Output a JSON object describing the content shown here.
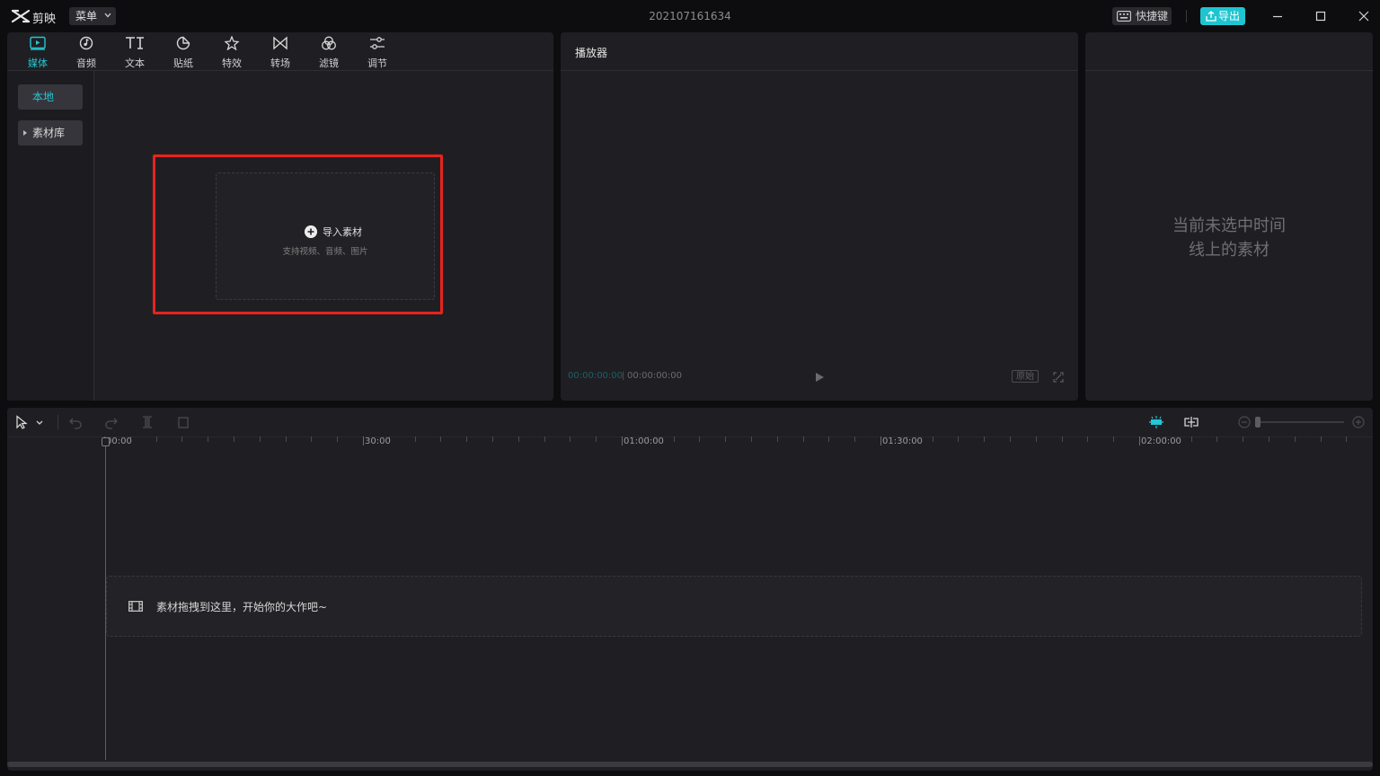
{
  "titlebar": {
    "app_name": "剪映",
    "menu_label": "菜单",
    "project_title": "202107161634",
    "shortcut_label": "快捷键",
    "export_label": "导出"
  },
  "media": {
    "tabs": [
      {
        "label": "媒体",
        "icon": "media-icon",
        "active": true
      },
      {
        "label": "音频",
        "icon": "audio-icon"
      },
      {
        "label": "文本",
        "icon": "text-icon"
      },
      {
        "label": "贴纸",
        "icon": "sticker-icon"
      },
      {
        "label": "特效",
        "icon": "effects-icon"
      },
      {
        "label": "转场",
        "icon": "transition-icon"
      },
      {
        "label": "滤镜",
        "icon": "filter-icon"
      },
      {
        "label": "调节",
        "icon": "adjust-icon"
      }
    ],
    "side": {
      "local": "本地",
      "library": "素材库"
    },
    "import_label": "导入素材",
    "import_hint": "支持视频、音频、图片"
  },
  "player": {
    "title": "播放器",
    "current_time": "00:00:00:00",
    "total_time": "00:00:00:00",
    "ratio_label": "原始"
  },
  "props": {
    "empty_line1": "当前未选中时间",
    "empty_line2": "线上的素材"
  },
  "timeline": {
    "ruler_labels": [
      "00:00",
      "30:00",
      "01:00:00",
      "01:30:00",
      "02:00:00"
    ],
    "drop_text": "素材拖拽到这里，开始你的大作吧~"
  },
  "colors": {
    "accent": "#1ec5d0",
    "highlight": "#e8231d",
    "panel": "#1f1f23",
    "background": "#0d0d0f"
  }
}
